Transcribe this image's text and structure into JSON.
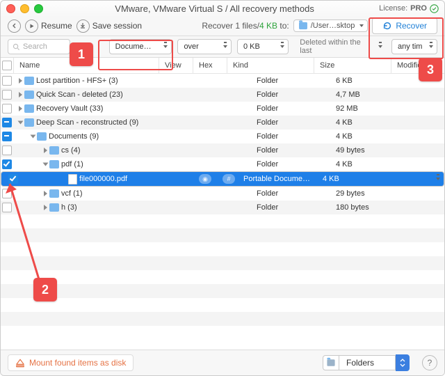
{
  "title": "VMware, VMware Virtual S / All recovery methods",
  "license": {
    "label": "License:",
    "value": "PRO"
  },
  "toolbar": {
    "resume": "Resume",
    "save": "Save session",
    "recover_pre": "Recover 1 files/",
    "recover_size": "4 KB",
    "recover_post": " to:",
    "path": "/User…sktop",
    "recover_btn": "Recover"
  },
  "filters": {
    "search": "Search",
    "kind": "Docume…",
    "op": "over",
    "size": "0 KB",
    "deleted": "Deleted within the last",
    "time": "any tim"
  },
  "columns": [
    "Name",
    "View",
    "Hex",
    "Kind",
    "Size",
    "Modificatio"
  ],
  "footer": {
    "mount": "Mount found items as disk",
    "mode": "Folders"
  },
  "annot": [
    "1",
    "2",
    "3"
  ],
  "rows": [
    {
      "indent": 0,
      "chk": "off",
      "expand": "right",
      "icon": "folder",
      "name": "Lost partition - HFS+ (3)",
      "kind": "Folder",
      "size": "6 KB"
    },
    {
      "indent": 0,
      "chk": "off",
      "expand": "right",
      "icon": "folder",
      "name": "Quick Scan - deleted (23)",
      "kind": "Folder",
      "size": "4,7 MB"
    },
    {
      "indent": 0,
      "chk": "off",
      "expand": "right",
      "icon": "folder",
      "name": "Recovery Vault (33)",
      "kind": "Folder",
      "size": "92 MB"
    },
    {
      "indent": 0,
      "chk": "mix",
      "expand": "down",
      "icon": "folder",
      "name": "Deep Scan - reconstructed (9)",
      "kind": "Folder",
      "size": "4 KB"
    },
    {
      "indent": 1,
      "chk": "mix",
      "expand": "down",
      "icon": "folder",
      "name": "Documents (9)",
      "kind": "Folder",
      "size": "4 KB"
    },
    {
      "indent": 2,
      "chk": "off",
      "expand": "right",
      "icon": "folder",
      "name": "cs (4)",
      "kind": "Folder",
      "size": "49 bytes"
    },
    {
      "indent": 2,
      "chk": "on",
      "expand": "down",
      "icon": "folder",
      "name": "pdf (1)",
      "kind": "Folder",
      "size": "4 KB"
    },
    {
      "indent": 3,
      "chk": "on",
      "expand": "",
      "icon": "file",
      "name": "file000000.pdf",
      "kind": "Portable Docume…",
      "size": "4 KB",
      "selected": true,
      "preview": true
    },
    {
      "indent": 2,
      "chk": "off",
      "expand": "right",
      "icon": "folder",
      "name": "vcf (1)",
      "kind": "Folder",
      "size": "29 bytes"
    },
    {
      "indent": 2,
      "chk": "off",
      "expand": "right",
      "icon": "folder",
      "name": "h (3)",
      "kind": "Folder",
      "size": "180 bytes"
    }
  ],
  "blank_rows": 8
}
